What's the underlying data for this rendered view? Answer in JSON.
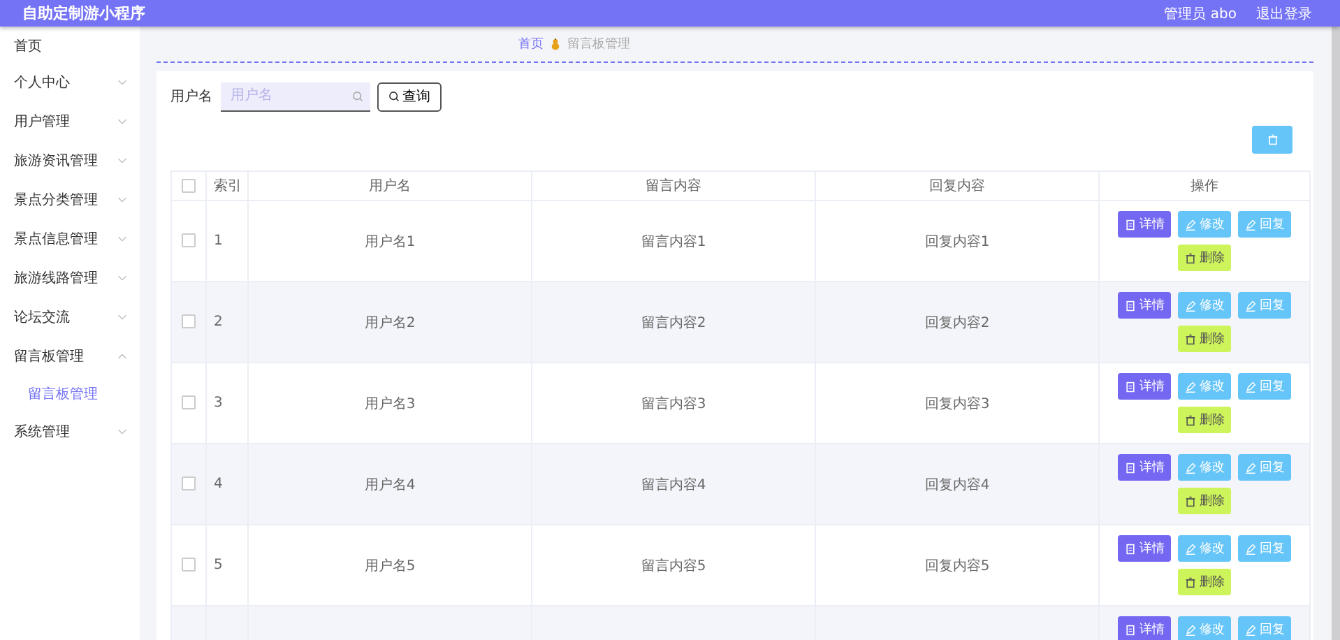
{
  "header": {
    "title": "自助定制游小程序",
    "user_label": "管理员 abo",
    "logout": "退出登录"
  },
  "sidebar": {
    "items": [
      {
        "label": "首页",
        "kind": "link"
      },
      {
        "label": "个人中心",
        "kind": "menu",
        "expanded": false
      },
      {
        "label": "用户管理",
        "kind": "menu",
        "expanded": false
      },
      {
        "label": "旅游资讯管理",
        "kind": "menu",
        "expanded": false
      },
      {
        "label": "景点分类管理",
        "kind": "menu",
        "expanded": false
      },
      {
        "label": "景点信息管理",
        "kind": "menu",
        "expanded": false
      },
      {
        "label": "旅游线路管理",
        "kind": "menu",
        "expanded": false
      },
      {
        "label": "论坛交流",
        "kind": "menu",
        "expanded": false
      },
      {
        "label": "留言板管理",
        "kind": "menu",
        "expanded": true,
        "children": [
          {
            "label": "留言板管理",
            "selected": true
          }
        ]
      },
      {
        "label": "系统管理",
        "kind": "menu",
        "expanded": false
      }
    ]
  },
  "breadcrumb": [
    "首页",
    "留言板管理"
  ],
  "search": {
    "label": "用户名",
    "placeholder": "用户名",
    "button": "查询"
  },
  "table": {
    "header_checked": false,
    "columns": [
      "索引",
      "用户名",
      "留言内容",
      "回复内容",
      "操作"
    ],
    "rows": [
      {
        "checked": false,
        "index": "1",
        "username": "用户名1",
        "message": "留言内容1",
        "reply": "回复内容1",
        "actions": [
          {
            "kind": "detail",
            "label": "详情"
          },
          {
            "kind": "edit",
            "label": "修改"
          },
          {
            "kind": "reply",
            "label": "回复"
          },
          {
            "kind": "delete",
            "label": "删除"
          }
        ]
      },
      {
        "checked": false,
        "index": "2",
        "username": "用户名2",
        "message": "留言内容2",
        "reply": "回复内容2",
        "actions": [
          {
            "kind": "detail",
            "label": "详情"
          },
          {
            "kind": "edit",
            "label": "修改"
          },
          {
            "kind": "reply",
            "label": "回复"
          },
          {
            "kind": "delete",
            "label": "删除"
          }
        ]
      },
      {
        "checked": false,
        "index": "3",
        "username": "用户名3",
        "message": "留言内容3",
        "reply": "回复内容3",
        "actions": [
          {
            "kind": "detail",
            "label": "详情"
          },
          {
            "kind": "edit",
            "label": "修改"
          },
          {
            "kind": "reply",
            "label": "回复"
          },
          {
            "kind": "delete",
            "label": "删除"
          }
        ]
      },
      {
        "checked": false,
        "index": "4",
        "username": "用户名4",
        "message": "留言内容4",
        "reply": "回复内容4",
        "actions": [
          {
            "kind": "detail",
            "label": "详情"
          },
          {
            "kind": "edit",
            "label": "修改"
          },
          {
            "kind": "reply",
            "label": "回复"
          },
          {
            "kind": "delete",
            "label": "删除"
          }
        ]
      },
      {
        "checked": false,
        "index": "5",
        "username": "用户名5",
        "message": "留言内容5",
        "reply": "回复内容5",
        "actions": [
          {
            "kind": "detail",
            "label": "详情"
          },
          {
            "kind": "edit",
            "label": "修改"
          },
          {
            "kind": "reply",
            "label": "回复"
          },
          {
            "kind": "delete",
            "label": "删除"
          }
        ]
      },
      {
        "actions": [
          {
            "kind": "detail",
            "label": "详情"
          },
          {
            "kind": "edit",
            "label": "修改"
          },
          {
            "kind": "reply",
            "label": "回复"
          }
        ]
      }
    ]
  }
}
